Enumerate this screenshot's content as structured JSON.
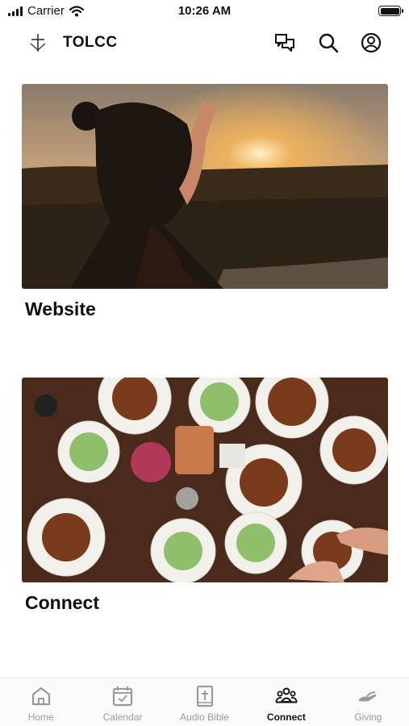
{
  "status_bar": {
    "carrier": "Carrier",
    "time": "10:26 AM"
  },
  "header": {
    "title": "TOLCC"
  },
  "cards": [
    {
      "title": "Website",
      "image": "woman-waving-at-sunset-photo"
    },
    {
      "title": "Connect",
      "image": "shared-meal-table-photo"
    }
  ],
  "tabbar": {
    "tabs": [
      {
        "label": "Home",
        "icon": "home-icon"
      },
      {
        "label": "Calendar",
        "icon": "calendar-check-icon"
      },
      {
        "label": "Audio Bible",
        "icon": "bible-icon"
      },
      {
        "label": "Connect",
        "icon": "people-icon"
      },
      {
        "label": "Giving",
        "icon": "giving-hand-icon"
      }
    ],
    "active": "Connect"
  },
  "colors": {
    "active": "#111111",
    "inactive": "#9a9a9a"
  }
}
